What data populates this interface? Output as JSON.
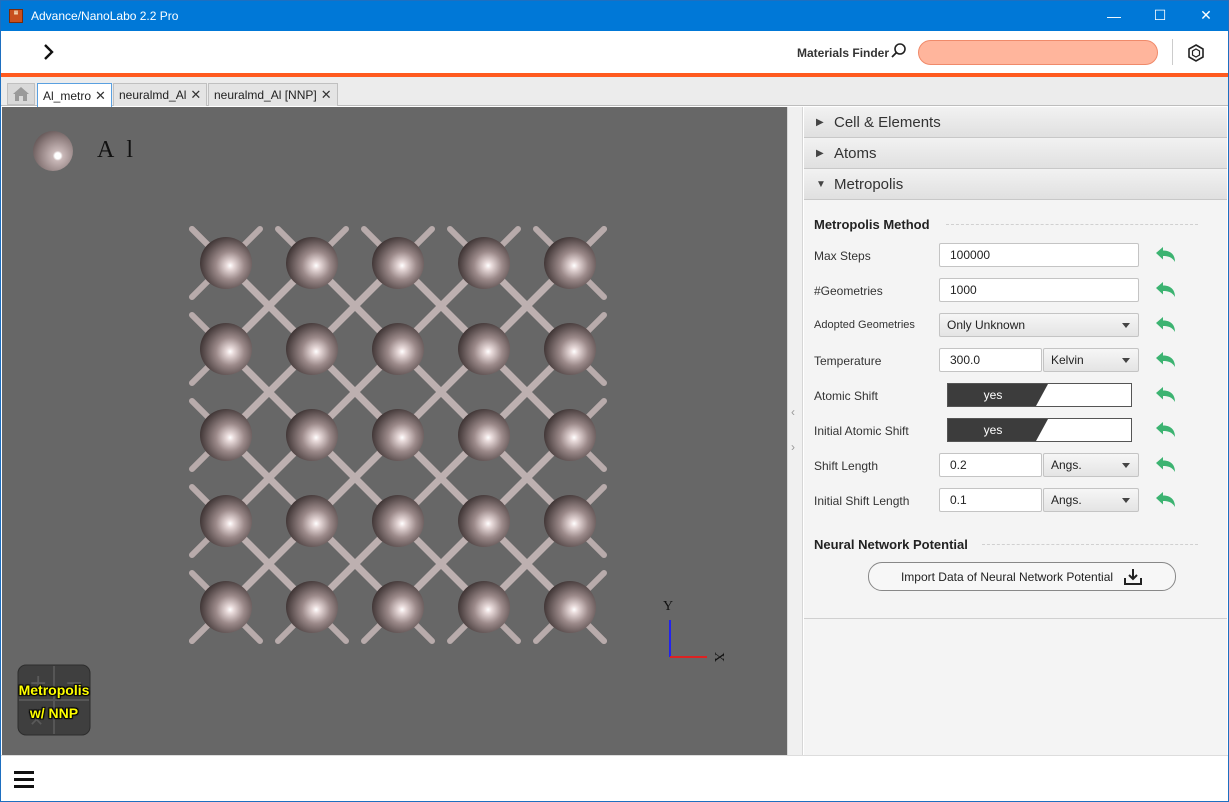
{
  "window": {
    "title": "Advance/NanoLabo 2.2 Pro",
    "minimize": "—",
    "maximize": "☐",
    "close": "✕"
  },
  "toolbar": {
    "materials_finder_label": "Materials Finder",
    "search_value": "",
    "search_placeholder": "",
    "search_color": "#ffb59c",
    "accent_color": "#ff5a1f"
  },
  "tabs": [
    {
      "label": "Al_metro",
      "active": true
    },
    {
      "label": "neuralmd_Al",
      "active": false
    },
    {
      "label": "neuralmd_Al [NNP]",
      "active": false
    }
  ],
  "tab_close": "✕",
  "viewer": {
    "element_legend": "Al",
    "axis_y": "Y",
    "axis_x": "X",
    "mode_line1": "Metropolis",
    "mode_line2": "w/ NNP",
    "background": "#676767"
  },
  "panel": {
    "sections": [
      {
        "label": "Cell & Elements",
        "expanded": false,
        "marker": "▶"
      },
      {
        "label": "Atoms",
        "expanded": false,
        "marker": "▶"
      },
      {
        "label": "Metropolis",
        "expanded": true,
        "marker": "▼"
      }
    ],
    "metropolis_method_title": "Metropolis Method",
    "rows": {
      "max_steps": {
        "label": "Max Steps",
        "value": "100000"
      },
      "geometries": {
        "label": "#Geometries",
        "value": "1000"
      },
      "adopted_geometries": {
        "label": "Adopted Geometries",
        "value": "Only Unknown"
      },
      "temperature": {
        "label": "Temperature",
        "value": "300.0",
        "unit": "Kelvin"
      },
      "atomic_shift": {
        "label": "Atomic Shift",
        "value": "yes"
      },
      "initial_atomic_shift": {
        "label": "Initial Atomic Shift",
        "value": "yes"
      },
      "shift_length": {
        "label": "Shift Length",
        "value": "0.2",
        "unit": "Angs."
      },
      "initial_shift_length": {
        "label": "Initial Shift Length",
        "value": "0.1",
        "unit": "Angs."
      }
    },
    "nnp_title": "Neural Network Potential",
    "import_button": "Import Data of Neural Network Potential",
    "undo_icon_color": "#3cb371"
  }
}
